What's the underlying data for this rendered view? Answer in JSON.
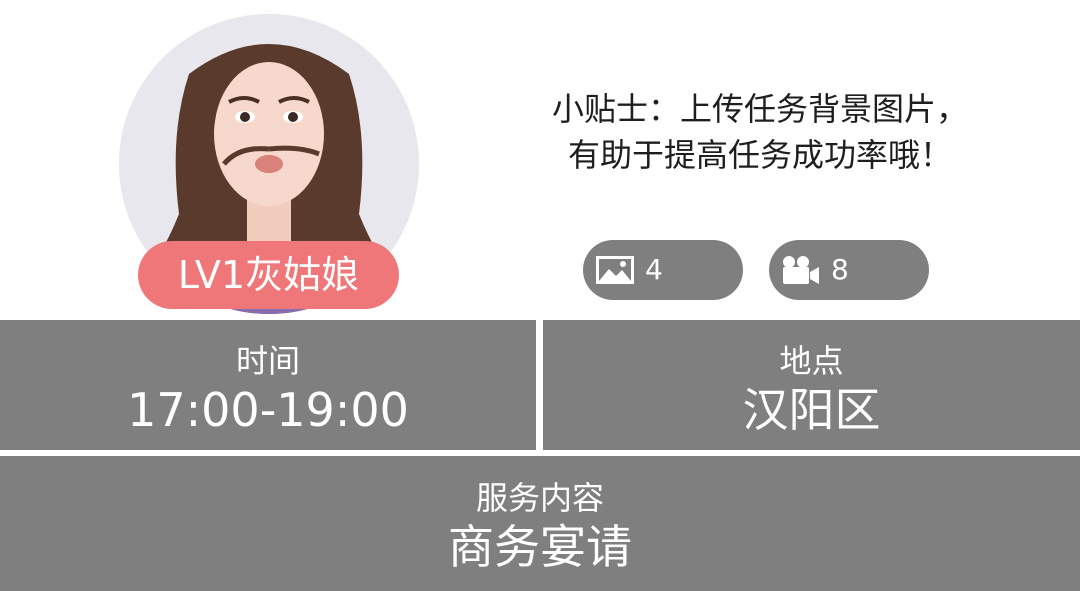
{
  "profile": {
    "level_badge": "LV1灰姑娘",
    "badge_color": "#f07779"
  },
  "tip": {
    "line1": "小贴士：上传任务背景图片，",
    "line2": "有助于提高任务成功率哦！"
  },
  "media": {
    "images": {
      "icon": "image-icon",
      "count": "4"
    },
    "videos": {
      "icon": "video-camera-icon",
      "count": "8"
    }
  },
  "info": {
    "time": {
      "label": "时间",
      "value": "17:00-19:00"
    },
    "place": {
      "label": "地点",
      "value": "汉阳区"
    },
    "service": {
      "label": "服务内容",
      "value": "商务宴请"
    }
  },
  "colors": {
    "panel": "#7f7f7f",
    "text_on_panel": "#ffffff",
    "tip_text": "#1e1e1e"
  }
}
